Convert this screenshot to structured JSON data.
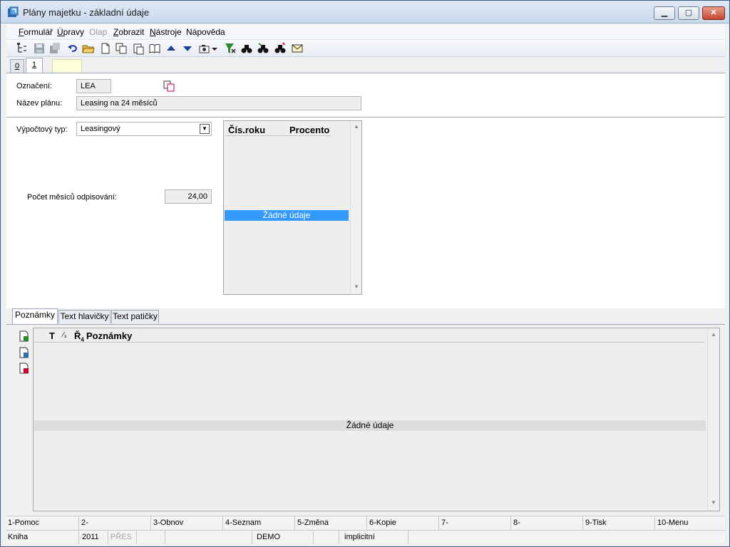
{
  "window": {
    "title": "Plány majetku - základní údaje"
  },
  "menu": {
    "items": [
      {
        "label": "Formulář",
        "accent": "F",
        "rest": "ormulář",
        "disabled": false
      },
      {
        "label": "Úpravy",
        "accent": "Ú",
        "rest": "pravy",
        "disabled": false
      },
      {
        "label": "Olap",
        "disabled": true
      },
      {
        "label": "Zobrazit",
        "accent": "Z",
        "rest": "obrazit",
        "disabled": false
      },
      {
        "label": "Nástroje",
        "accent": "N",
        "rest": "ástroje",
        "disabled": false
      },
      {
        "label": "Nápověda",
        "disabled": false
      }
    ]
  },
  "record_tabs": {
    "tab0": "0",
    "tab1": "1"
  },
  "form": {
    "oznaceni_label": "Označení:",
    "oznaceni_value": "LEA",
    "nazev_label": "Název plánu:",
    "nazev_value": "Leasing na 24 měsíců",
    "typ_label": "Výpočtový typ:",
    "typ_value": "Leasingový",
    "pocet_label": "Počet měsíců odpisování:",
    "pocet_value": "24,00"
  },
  "rate_grid": {
    "col1": "Čís.roku",
    "col2": "Procento",
    "empty": "Žádné údaje"
  },
  "lower_tabs": {
    "notes": "Poznámky",
    "header_text": "Text hlavičky",
    "footer_text": "Text patičky"
  },
  "notes_grid": {
    "col_t": "T",
    "col_poznamky": "Poznámky",
    "empty": "Žádné údaje"
  },
  "fkeys": [
    "1-Pomoc",
    "2-",
    "3-Obnov",
    "4-Seznam",
    "5-Změna",
    "6-Kopie",
    "7-",
    "8-",
    "9-Tisk",
    "10-Menu"
  ],
  "status": {
    "mode": "Kniha",
    "year": "2011",
    "overwrite": "PŘES",
    "db": "DEMO",
    "profile": "implicitní"
  },
  "colors": {
    "selection": "#3399ff",
    "title_bg": "#c9d9ec"
  }
}
